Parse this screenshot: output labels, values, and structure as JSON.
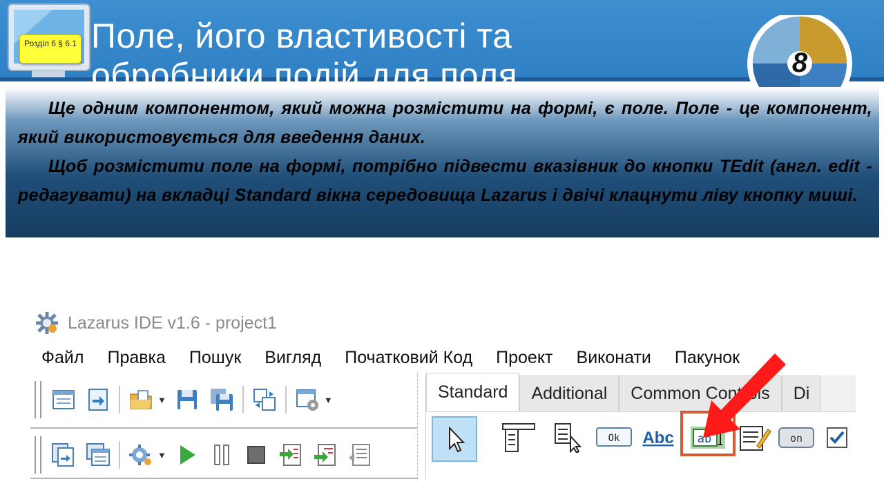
{
  "slide": {
    "badge": "Розділ 6 § 6.1",
    "title": "Поле, його властивості та обробники подій для поля",
    "grade": "8",
    "paragraph1": "Ще одним компонентом, який можна розмістити на формі, є поле. Поле - це компонент, який використовується для введення даних.",
    "paragraph2": "Щоб розмістити поле на формі, потрібно підвести вказівник до кнопки TEdit (англ. edit - редагувати) на вкладці Standard вікна середовища Lazarus і двічі клацнути ліву кнопку миші."
  },
  "ide": {
    "window_title": "Lazarus IDE v1.6 - project1",
    "menu": [
      "Файл",
      "Правка",
      "Пошук",
      "Вигляд",
      "Початковий Код",
      "Проект",
      "Виконати",
      "Пакунок"
    ],
    "toolbar_row1": [
      "new-form-icon",
      "new-unit-icon",
      "open-icon",
      "save-icon",
      "save-all-icon",
      "toggle-form-unit-icon",
      "project-options-icon"
    ],
    "toolbar_row2": [
      "view-units-icon",
      "view-forms-icon",
      "build-mode-icon",
      "run-icon",
      "pause-icon",
      "stop-icon",
      "step-into-icon",
      "step-over-icon",
      "step-out-icon"
    ],
    "palette_tabs": [
      "Standard",
      "Additional",
      "Common Controls",
      "Di"
    ],
    "active_tab": "Standard",
    "components": {
      "button_caption": "Ok",
      "label_caption": "Abc",
      "edit_caption": "ab",
      "toggle_caption": "on"
    }
  },
  "colors": {
    "header": "#3d8fd0",
    "badge": "#ffff3a",
    "highlight_frame": "#d55a3a",
    "arrow": "#ff1a1a"
  }
}
